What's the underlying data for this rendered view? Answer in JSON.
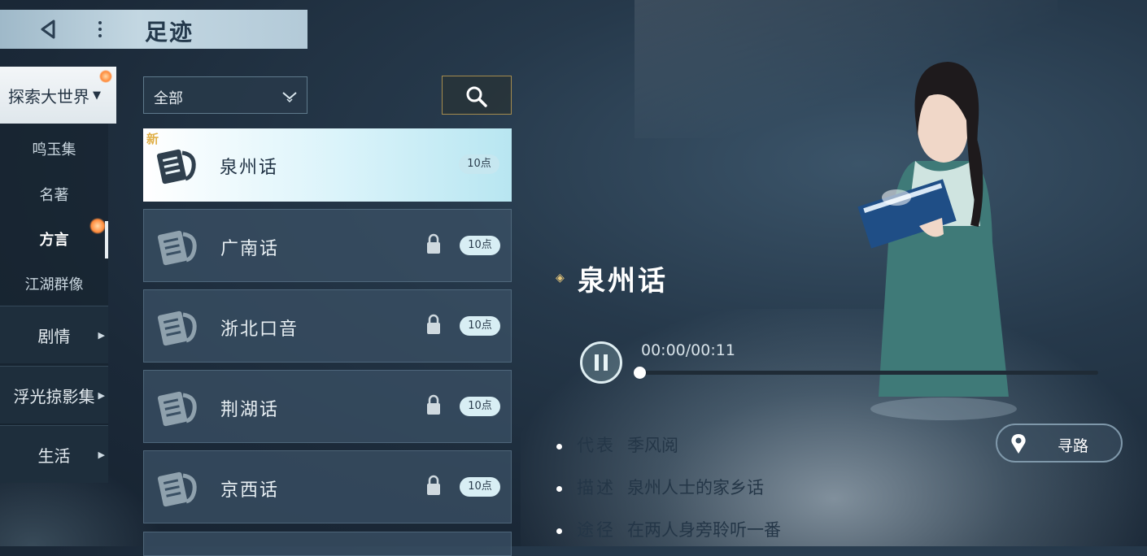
{
  "header": {
    "title": "足迹",
    "back_icon": "back-arrow-icon",
    "more_icon": "more-dots-icon"
  },
  "categories": {
    "main": {
      "label": "探索大世界"
    },
    "sub_items": [
      {
        "label": "鸣玉集"
      },
      {
        "label": "名著"
      },
      {
        "label": "方言",
        "active": true
      },
      {
        "label": "江湖群像"
      }
    ],
    "rows": [
      {
        "label": "剧情"
      },
      {
        "label": "浮光掠影集"
      },
      {
        "label": "生活"
      }
    ]
  },
  "filter": {
    "value": "全部"
  },
  "list": [
    {
      "name": "泉州话",
      "points": "10点",
      "new_tag": "新",
      "locked": false,
      "selected": true
    },
    {
      "name": "广南话",
      "points": "10点",
      "locked": true
    },
    {
      "name": "浙北口音",
      "points": "10点",
      "locked": true
    },
    {
      "name": "荆湖话",
      "points": "10点",
      "locked": true
    },
    {
      "name": "京西话",
      "points": "10点",
      "locked": true
    }
  ],
  "detail": {
    "title": "泉州话",
    "player": {
      "time": "00:00/00:11",
      "progress": 0
    },
    "info": [
      {
        "label": "代表",
        "value": "季风阅"
      },
      {
        "label": "描述",
        "value": "泉州人士的家乡话"
      },
      {
        "label": "途径",
        "value": "在两人身旁聆听一番"
      }
    ],
    "route_button": "寻路"
  },
  "colors": {
    "accent_gold": "#e6c77b",
    "selected_bg": "#d9f3fa",
    "badge_bg": "#d8eef4"
  }
}
